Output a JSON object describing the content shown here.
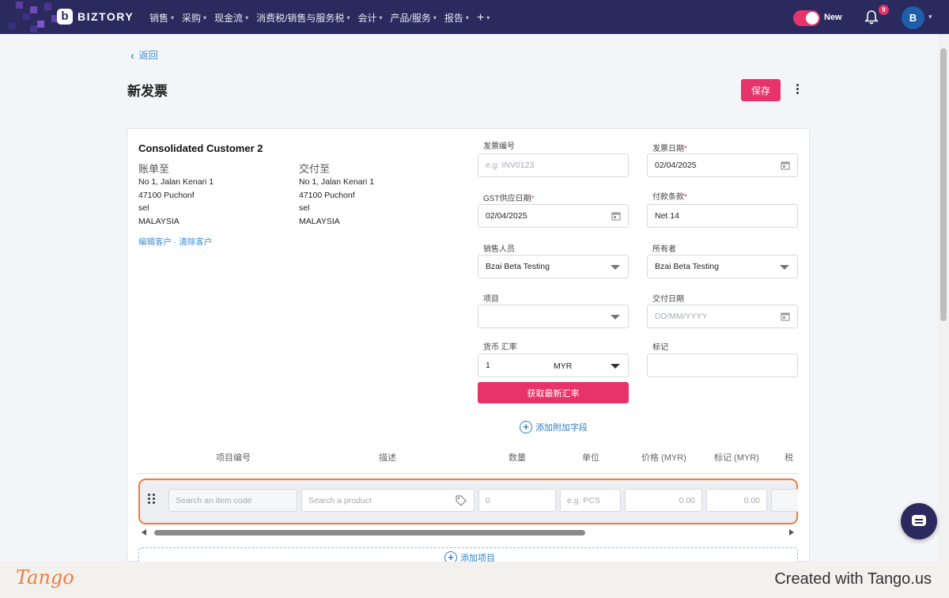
{
  "nav": {
    "brand": "BIZTORY",
    "menu": [
      "销售",
      "采购",
      "现金流",
      "消费税/销售与服务税",
      "会计",
      "产品/服务",
      "报告",
      "+"
    ],
    "toggle_label": "New",
    "notification_count": "9",
    "avatar_initial": "B"
  },
  "page": {
    "back_label": "返回",
    "title": "新发票",
    "save_label": "保存"
  },
  "customer": {
    "name": "Consolidated Customer 2",
    "billing": {
      "title": "账单至",
      "lines": [
        "No 1, Jalan Kenari 1",
        "47100 Puchonf",
        "sel",
        "MALAYSIA"
      ]
    },
    "shipping": {
      "title": "交付至",
      "lines": [
        "No 1, Jalan Kenari 1",
        "47100 Puchonf",
        "sel",
        "MALAYSIA"
      ]
    },
    "links": "编辑客户 · 清除客户"
  },
  "form": {
    "invoice_no": {
      "label": "发票编号",
      "placeholder": "e.g: INV0123"
    },
    "invoice_date": {
      "label": "发票日期",
      "required": "*",
      "value": "02/04/2025"
    },
    "gst_date": {
      "label": "GST供应日期",
      "required": "*",
      "value": "02/04/2025"
    },
    "payment_terms": {
      "label": "付款条款",
      "required": "*",
      "value": "Net 14"
    },
    "salesperson": {
      "label": "销售人员",
      "value": "Bzai Beta Testing"
    },
    "owner": {
      "label": "所有者",
      "value": "Bzai Beta Testing"
    },
    "project": {
      "label": "项目",
      "value": ""
    },
    "delivery_date": {
      "label": "交付日期",
      "placeholder": "DD/MM/YYYY"
    },
    "currency": {
      "label": "货币 汇率",
      "rate": "1",
      "code": "MYR"
    },
    "tag": {
      "label": "标记",
      "value": ""
    },
    "fetch_rate_label": "获取最新汇率",
    "add_field_label": "添加附加字段"
  },
  "items": {
    "headers": [
      "项目编号",
      "描述",
      "数量",
      "单位",
      "价格 (MYR)",
      "标记 (MYR)",
      "税"
    ],
    "row": {
      "item_code_placeholder": "Search an item code",
      "product_placeholder": "Search a product",
      "qty_placeholder": "0",
      "unit_placeholder": "e.g. PCS",
      "price_value": "0.00",
      "tag_value": "0.00"
    },
    "add_item_label": "添加项目"
  },
  "footer": {
    "logo": "Tango",
    "credit": "Created with Tango.us"
  },
  "colors": {
    "nav_bg": "#2a2a5e",
    "accent": "#e8336a",
    "link": "#3a8fd6",
    "highlight": "#ef7c3a"
  }
}
